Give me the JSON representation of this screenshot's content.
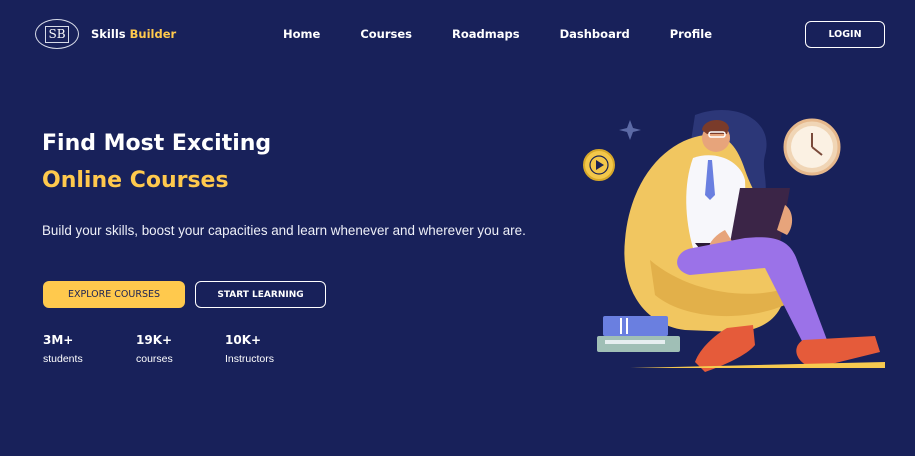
{
  "navbar": {
    "logo": {
      "badge": "SB",
      "brand_first": "Skills",
      "brand_second": "Builder"
    },
    "links": [
      "Home",
      "Courses",
      "Roadmaps",
      "Dashboard",
      "Profile"
    ],
    "login_label": "LOGIN"
  },
  "hero": {
    "title": "Find Most Exciting",
    "subtitle": "Online Courses",
    "description": "Build your skills, boost your capacities and learn whenever and wherever you are.",
    "primary_button": "EXPLORE COURSES",
    "secondary_button": "START LEARNING",
    "stats": [
      {
        "value": "3M+",
        "label": "students"
      },
      {
        "value": "19K+",
        "label": "courses"
      },
      {
        "value": "10K+",
        "label": "Instructors"
      }
    ]
  },
  "colors": {
    "background": "#18215a",
    "accent": "#ffc94d",
    "text": "#ffffff"
  },
  "icons": [
    "sparkle-icon",
    "play-badge-icon",
    "clock-icon",
    "book-stack-icon"
  ]
}
